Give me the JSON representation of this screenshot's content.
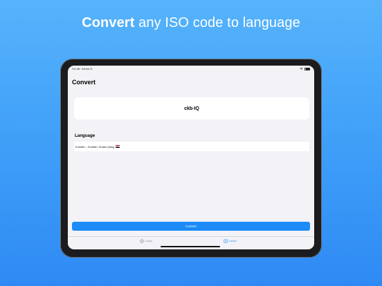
{
  "headline": {
    "bold": "Convert",
    "rest": " any ISO code to language"
  },
  "status_bar": {
    "time": "9:41 AM",
    "date": "Sat Nov 21"
  },
  "screen": {
    "title": "Convert",
    "code_value": "ckb-IQ",
    "section_header": "Language",
    "result_text": "Kurdish – Kurdish, Sorani (Iraq)",
    "convert_button_label": "Convert"
  },
  "tabs": [
    {
      "label": "Lookup",
      "icon": "globe-icon",
      "selected": false
    },
    {
      "label": "Convert",
      "icon": "convert-icon",
      "selected": true
    }
  ],
  "colors": {
    "background_top": "#56b3fb",
    "background_bottom": "#2f8af3",
    "accent": "#1d8cf8",
    "screen_bg": "#f2f2f7"
  }
}
